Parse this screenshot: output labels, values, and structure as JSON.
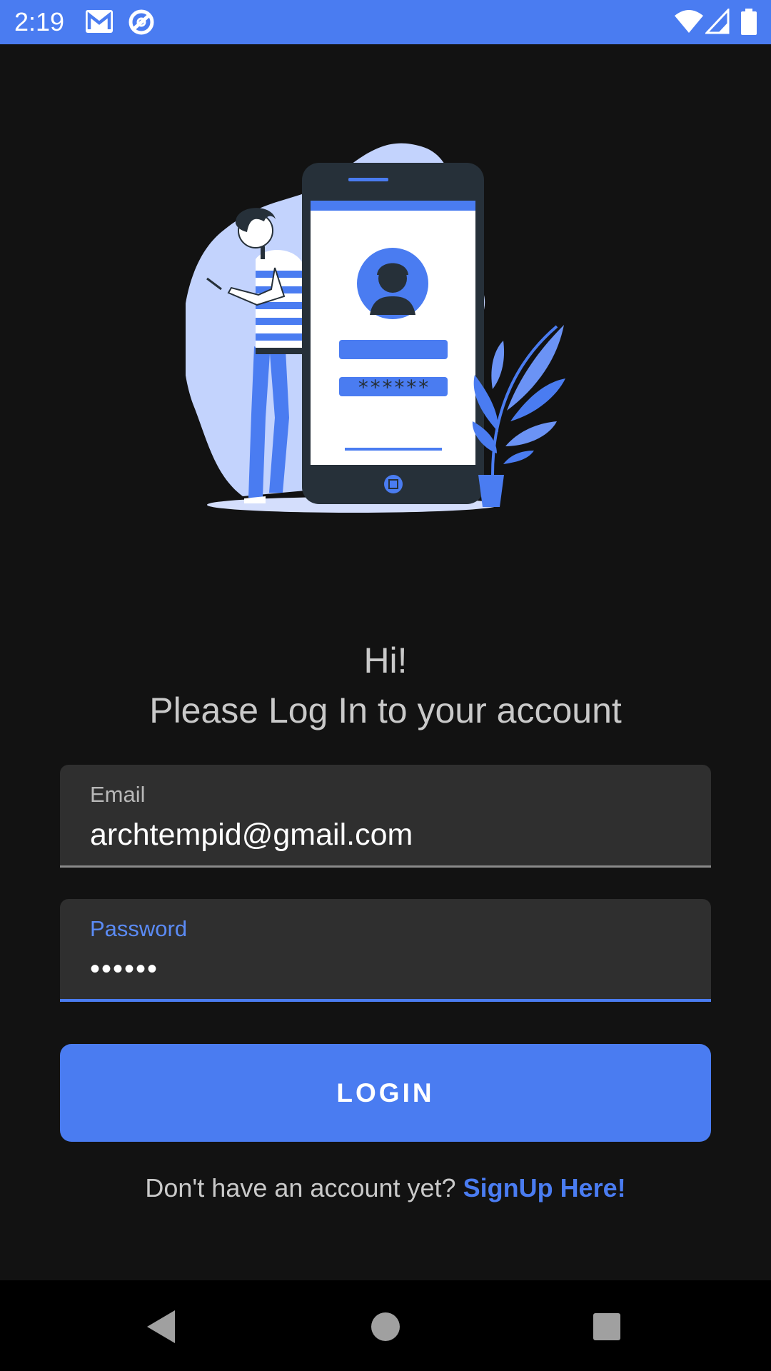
{
  "status_bar": {
    "time": "2:19",
    "icons": [
      "gmail-icon",
      "sync-icon",
      "wifi-icon",
      "signal-icon",
      "battery-icon"
    ],
    "background": "#4a7cf1"
  },
  "hero": {
    "password_mask": "******"
  },
  "heading": {
    "greeting": "Hi!",
    "subtitle": "Please Log In to your account"
  },
  "form": {
    "email": {
      "label": "Email",
      "value": "archtempid@gmail.com"
    },
    "password": {
      "label": "Password",
      "value": "••••••"
    },
    "login_label": "LOGIN"
  },
  "signup": {
    "prompt": "Don't have an account yet?",
    "link": "SignUp Here!"
  },
  "nav_bar": {
    "buttons": [
      "back",
      "home",
      "recents"
    ]
  },
  "colors": {
    "accent": "#4a7cf1",
    "background": "#121212",
    "field_bg": "#2f2f2f",
    "illustration_blob": "#c3d3fd",
    "illustration_phone": "#263039"
  }
}
